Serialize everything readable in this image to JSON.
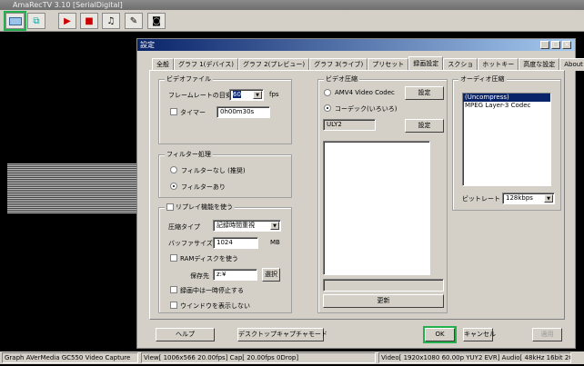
{
  "app": {
    "title": "AmaRecTV 3.10  [SerialDigital]"
  },
  "toolbar": {
    "buttons": [
      "display-icon",
      "graph-icon",
      "play-icon",
      "camera-icon",
      "music-icon",
      "mic-icon",
      "speaker-icon"
    ]
  },
  "dialog": {
    "title": "設定",
    "tabs": [
      "全般",
      "グラフ 1(デバイス)",
      "グラフ 2(プレビュー)",
      "グラフ 3(ライブ)",
      "プリセット",
      "録画設定",
      "スクショ",
      "ホットキー",
      "高度な設定",
      "About"
    ],
    "active_tab": "録画設定",
    "video_file": {
      "title": "ビデオファイル",
      "framerate_label": "フレームレートの目安",
      "framerate_value": "60",
      "fps_unit": "fps",
      "timer_label": "タイマー",
      "timer_value": "0h00m30s"
    },
    "filter": {
      "title": "フィルター処理",
      "option_none": "フィルターなし (推奨)",
      "option_on": "フィルターあり"
    },
    "replay": {
      "title": "リプレイ機能を使う",
      "compress_label": "圧縮タイプ",
      "compress_value": "記録時間重視",
      "buffer_label": "バッファサイズ",
      "buffer_value": "1024",
      "buffer_unit": "MB",
      "ramdisk_label": "RAMディスクを使う",
      "save_label": "保存先",
      "save_value": "z:¥",
      "select_button": "選択",
      "pause_label": "録画中は一時停止する",
      "hide_window_label": "ウインドウを表示しない"
    },
    "video_compress": {
      "title": "ビデオ圧縮",
      "amv4_label": "AMV4 Video Codec",
      "settings_button": "設定",
      "codec_label": "コーデック(いろいろ)",
      "codec_value": "ULY2",
      "settings_button2": "設定",
      "update_button": "更新"
    },
    "audio_compress": {
      "title": "オーディオ圧縮",
      "items": [
        "(Uncompress)",
        "MPEG Layer-3 Codec"
      ],
      "bitrate_label": "ビットレート",
      "bitrate_value": "128kbps"
    },
    "buttons": {
      "help": "ヘルプ",
      "desktop": "デスクトップキャプチャモード",
      "ok": "OK",
      "cancel": "キャンセル",
      "apply": "適用"
    }
  },
  "status": {
    "graph": "Graph AVerMedia GC550 Video Capture",
    "view": "View[ 1006x566 20.00fps]  Cap[ 20.00fps 0Drop]",
    "video": "Video[ 1920x1080 60.00p YUY2 EVR]  Audio[ 48kHz 16bit 2Ch]"
  }
}
